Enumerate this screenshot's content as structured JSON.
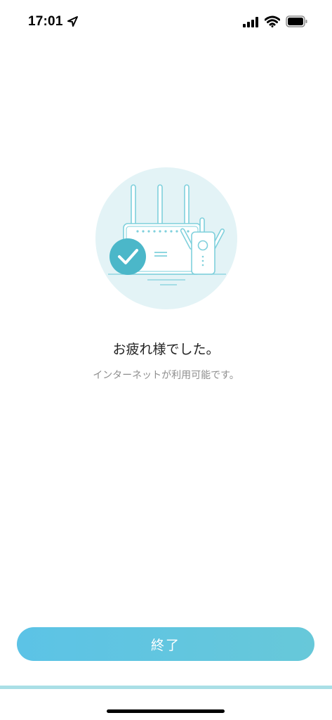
{
  "status_bar": {
    "time": "17:01",
    "icons": [
      "location-arrow-icon",
      "cellular-signal-icon",
      "wifi-icon",
      "battery-icon"
    ]
  },
  "illustration": {
    "icon": "router-extender-success-illustration",
    "colors": {
      "circle_bg": "#e3f3f6",
      "line": "#7fd0dc",
      "check_circle": "#4bb7c9"
    }
  },
  "content": {
    "title": "お疲れ様でした。",
    "subtitle": "インターネットが利用可能です。"
  },
  "button": {
    "finish_label": "終了",
    "color": "#5cc3e6"
  }
}
